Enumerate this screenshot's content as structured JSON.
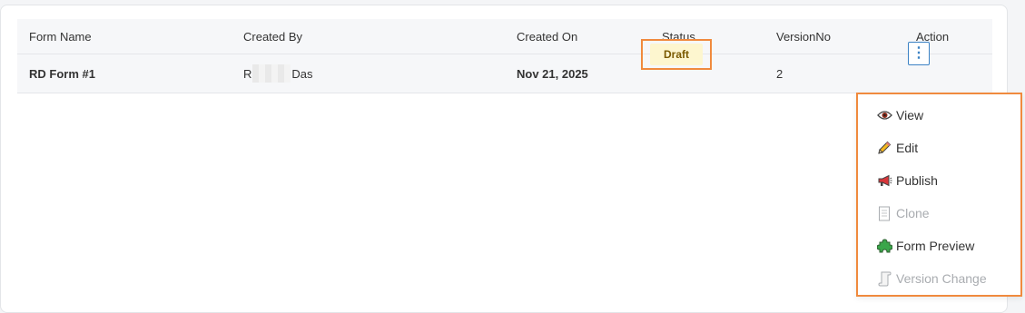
{
  "table": {
    "headers": {
      "form_name": "Form Name",
      "created_by": "Created By",
      "created_on": "Created On",
      "status": "Status",
      "version_no": "VersionNo",
      "action": "Action"
    },
    "rows": [
      {
        "form_name": "RD Form #1",
        "created_by_start": "R",
        "created_by_end": "Das",
        "created_on": "Nov 21, 2025",
        "status": "Draft",
        "version_no": "2",
        "action_icon": "vertical-ellipsis-icon",
        "action_glyph": "⋮"
      }
    ]
  },
  "action_menu": {
    "items": [
      {
        "label": "View",
        "icon": "eye-icon",
        "enabled": true
      },
      {
        "label": "Edit",
        "icon": "pencil-icon",
        "enabled": true
      },
      {
        "label": "Publish",
        "icon": "megaphone-icon",
        "enabled": true
      },
      {
        "label": "Clone",
        "icon": "document-icon",
        "enabled": false
      },
      {
        "label": "Form Preview",
        "icon": "puzzle-piece-icon",
        "enabled": true
      },
      {
        "label": "Version Change",
        "icon": "scroll-icon",
        "enabled": false
      }
    ]
  },
  "colors": {
    "highlight_border": "#f08a3e",
    "draft_badge_bg": "#fdf6cf",
    "action_button_border": "#3b82c4",
    "disabled_text": "#a9acb0"
  }
}
